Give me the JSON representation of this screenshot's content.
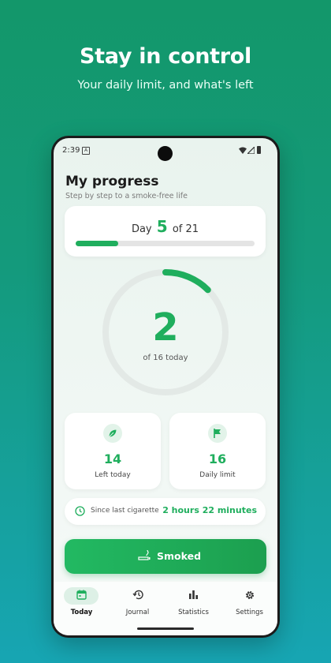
{
  "promo": {
    "headline": "Stay in control",
    "subline": "Your daily limit, and what's left"
  },
  "status_bar": {
    "time": "2:39",
    "notification_icon": "A",
    "icons": [
      "wifi-icon",
      "signal-icon",
      "battery-icon"
    ]
  },
  "header": {
    "title": "My progress",
    "subtitle": "Step by step to a smoke-free life"
  },
  "day_progress": {
    "prefix": "Day",
    "day": "5",
    "suffix": "of 21",
    "fraction": 0.2381
  },
  "today_ring": {
    "count": "2",
    "caption": "of 16 today",
    "fraction": 0.125
  },
  "stats": {
    "left_today": {
      "value": "14",
      "label": "Left today",
      "icon": "leaf-icon"
    },
    "daily_limit": {
      "value": "16",
      "label": "Daily limit",
      "icon": "flag-icon"
    }
  },
  "since_last": {
    "label": "Since last cigarette",
    "value": "2 hours 22 minutes",
    "icon": "clock-icon"
  },
  "smoked_button": {
    "label": "Smoked",
    "icon": "cigarette-icon"
  },
  "nav": {
    "items": [
      {
        "label": "Today",
        "icon": "calendar-icon",
        "active": true
      },
      {
        "label": "Journal",
        "icon": "history-icon",
        "active": false
      },
      {
        "label": "Statistics",
        "icon": "bar-chart-icon",
        "active": false
      },
      {
        "label": "Settings",
        "icon": "gear-icon",
        "active": false
      }
    ]
  },
  "colors": {
    "accent": "#1fae5d",
    "background_top": "#13976a",
    "background_bottom": "#17a5b3"
  }
}
